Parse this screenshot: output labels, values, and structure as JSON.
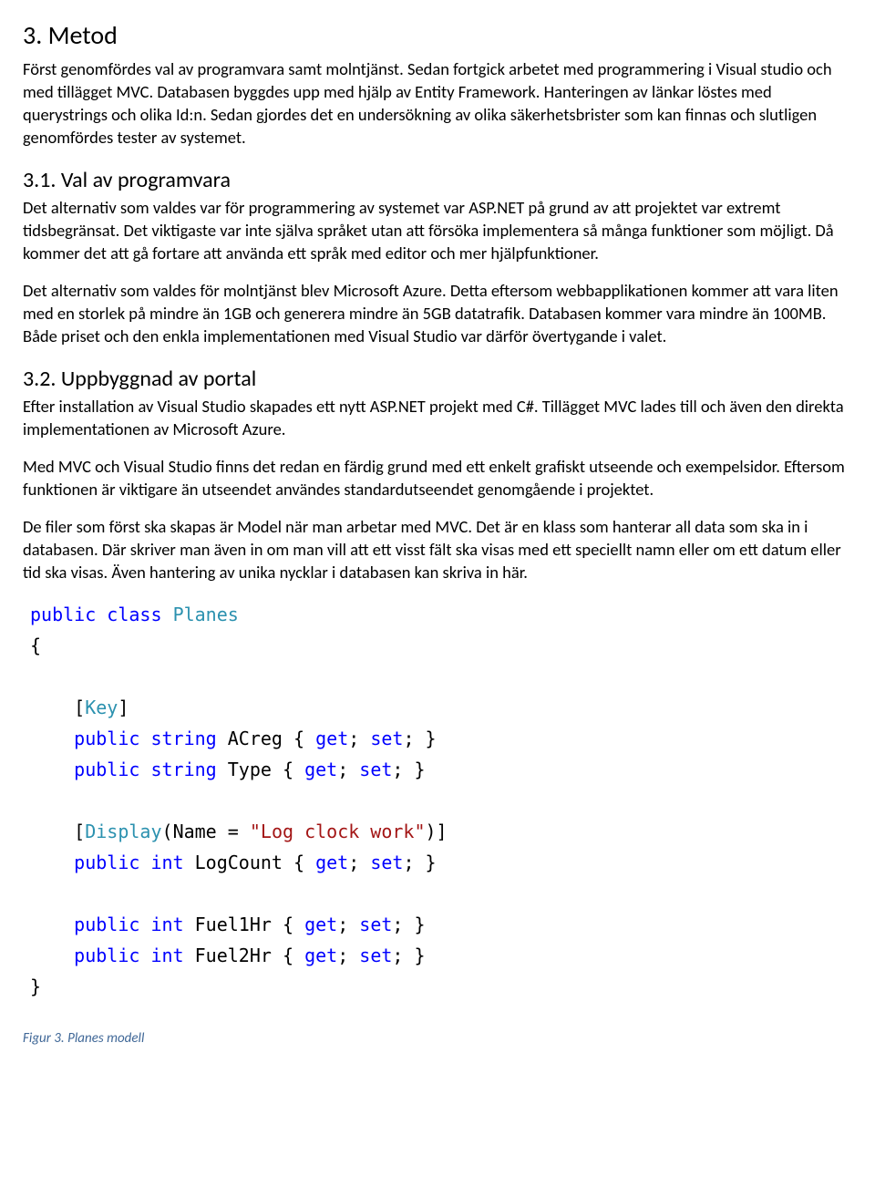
{
  "h1": "3.  Metod",
  "p1": "Först genomfördes val av programvara samt molntjänst. Sedan fortgick arbetet med programmering i Visual studio och med tillägget MVC. Databasen byggdes upp med hjälp av Entity Framework. Hanteringen av länkar löstes med querystrings och olika Id:n. Sedan gjordes det en undersökning av olika säkerhetsbrister som kan finnas och slutligen genomfördes tester av systemet.",
  "h2a": "3.1. Val av programvara",
  "p2": "Det alternativ som valdes var för programmering av systemet var ASP.NET på grund av att projektet var extremt tidsbegränsat. Det viktigaste var inte själva språket utan att försöka implementera så många funktioner som möjligt. Då kommer det att gå fortare att använda ett språk med editor och mer hjälpfunktioner.",
  "p3": "Det alternativ som valdes för molntjänst blev Microsoft Azure. Detta eftersom webbapplikationen kommer att vara liten med en storlek på mindre än 1GB och generera mindre än 5GB datatrafik. Databasen kommer vara mindre än 100MB. Både priset och den enkla implementationen med Visual Studio var därför övertygande i valet.",
  "h2b": "3.2. Uppbyggnad av portal",
  "p4": "Efter installation av Visual Studio skapades ett nytt ASP.NET projekt med C#. Tillägget MVC lades till och även den direkta implementationen av Microsoft Azure.",
  "p5": "Med MVC och Visual Studio finns det redan en färdig grund med ett enkelt grafiskt utseende och exempelsidor. Eftersom funktionen är viktigare än utseendet användes standardutseendet genomgående i projektet.",
  "p6": "De filer som först ska skapas är Model när man arbetar med MVC. Det är en klass som hanterar all data som ska in i databasen. Där skriver man även in om man vill att ett visst fält ska visas med ett speciellt namn eller om ett datum eller tid ska visas. Även hantering av unika nycklar i databasen kan skriva in här.",
  "code": {
    "kw_public": "public",
    "kw_class": "class",
    "kw_string": "string",
    "kw_int": "int",
    "kw_get": "get",
    "kw_set": "set",
    "ty_planes": "Planes",
    "ty_key": "Key",
    "ty_display": "Display",
    "id_acreg": "ACreg",
    "id_type": "Type",
    "id_logcount": "LogCount",
    "id_fuel1": "Fuel1Hr",
    "id_fuel2": "Fuel2Hr",
    "id_name": "Name",
    "str_log": "\"Log clock work\""
  },
  "caption": "Figur 3. Planes modell"
}
